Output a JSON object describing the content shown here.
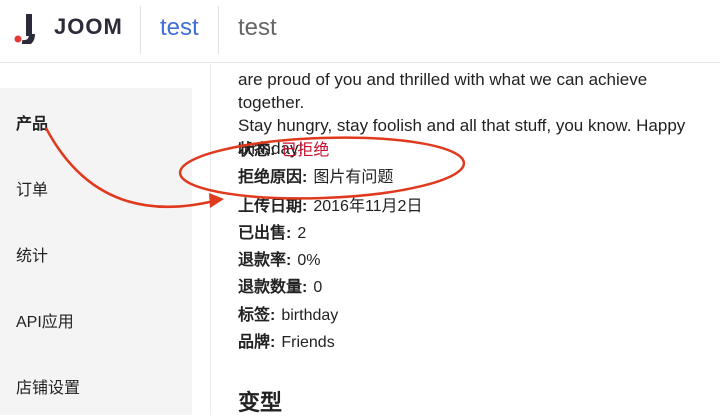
{
  "header": {
    "logo_text": "JOOM",
    "tab_active": "test",
    "tab_inactive": "test"
  },
  "sidebar": {
    "items": [
      {
        "label": "产品"
      },
      {
        "label": "订单"
      },
      {
        "label": "统计"
      },
      {
        "label": "API应用"
      },
      {
        "label": "店铺设置"
      }
    ]
  },
  "content": {
    "description_lines": [
      "are proud of you and thrilled with what we can achieve together.",
      "Stay hungry, stay foolish and all that stuff, you know. Happy",
      "birthday!"
    ],
    "fields": [
      {
        "key": "状态:",
        "value": "已拒绝"
      },
      {
        "key": "拒绝原因:",
        "value": "图片有问题"
      },
      {
        "key": "上传日期:",
        "value": "2016年11月2日"
      },
      {
        "key": "已出售:",
        "value": "2"
      },
      {
        "key": "退款率:",
        "value": "0%"
      },
      {
        "key": "退款数量:",
        "value": "0"
      },
      {
        "key": "标签:",
        "value": "birthday"
      },
      {
        "key": "品牌:",
        "value": "Friends"
      }
    ],
    "variants_title": "变型"
  },
  "colors": {
    "accent": "#3f6fd8",
    "rejected": "#c8102e",
    "annotation": "#e03a1e"
  }
}
